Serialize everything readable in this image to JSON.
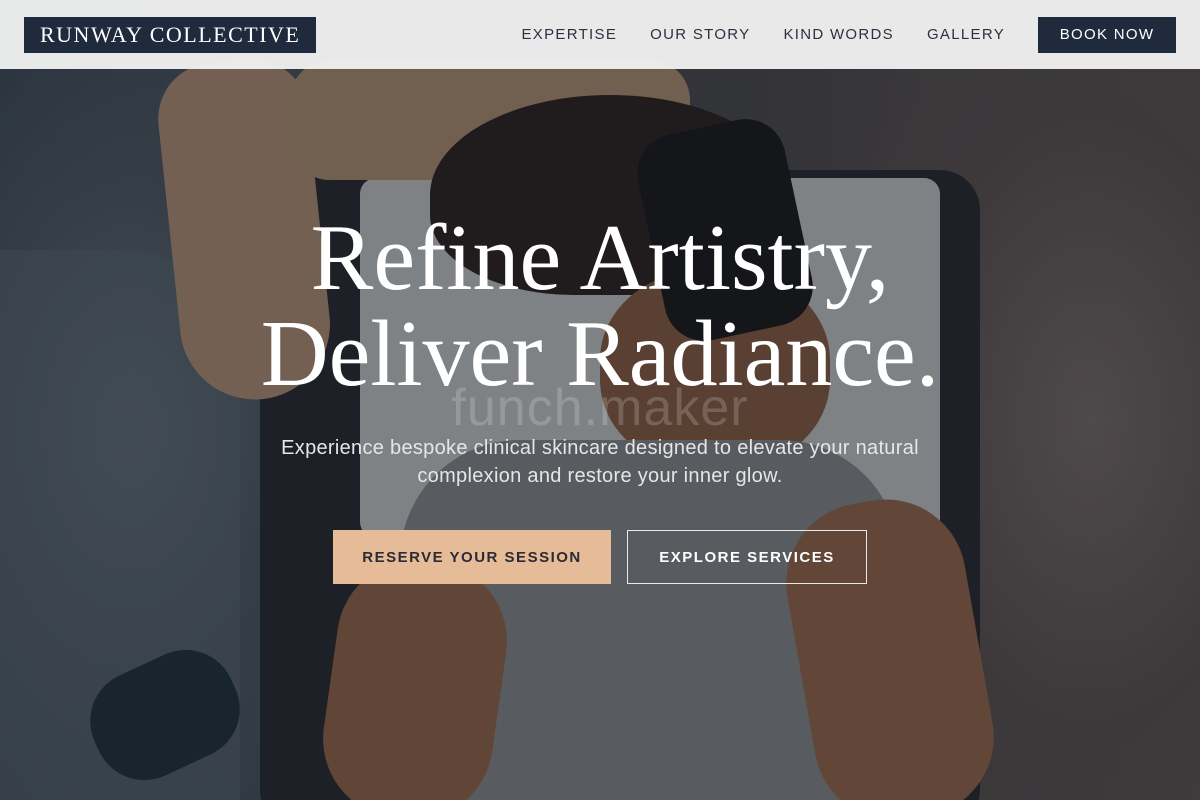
{
  "header": {
    "logo": "RUNWAY COLLECTIVE",
    "nav": [
      "EXPERTISE",
      "OUR STORY",
      "KIND WORDS",
      "GALLERY"
    ],
    "cta": "BOOK NOW"
  },
  "hero": {
    "headline_line1": "Refine Artistry,",
    "headline_line2": "Deliver Radiance.",
    "watermark": "funch.maker",
    "subtext": "Experience bespoke clinical skincare designed to elevate your natural complexion and restore your inner glow.",
    "primary_button": "RESERVE YOUR SESSION",
    "secondary_button": "EXPLORE SERVICES"
  },
  "colors": {
    "navy": "#1f2a3d",
    "accent": "#e6bb98",
    "header_bg": "#f0f0f0"
  }
}
